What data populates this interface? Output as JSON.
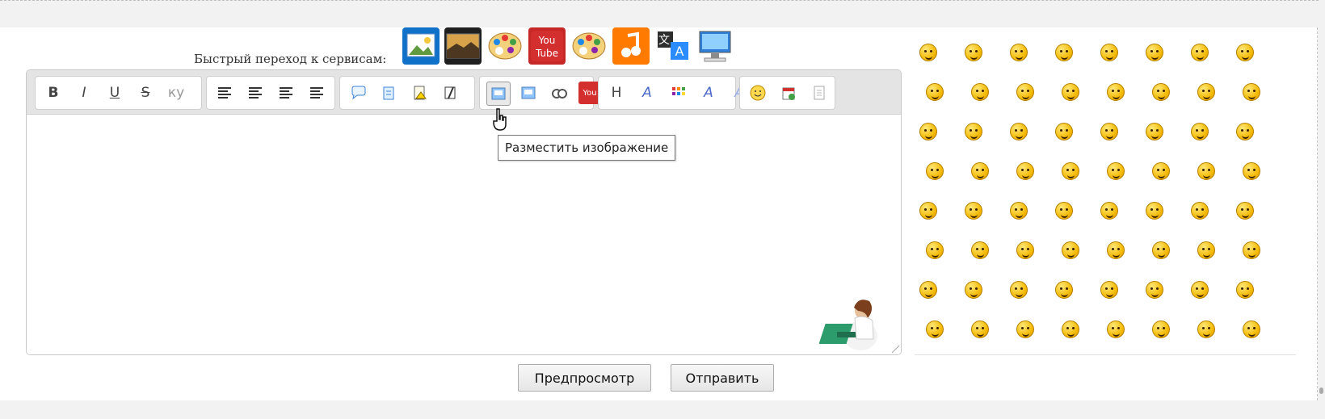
{
  "quick_services_label": "Быстрый переход к сервисам:",
  "service_icons": [
    "photo-icon",
    "sunset-photo-icon",
    "palette-icon",
    "youtube-icon",
    "palette-icon",
    "music-icon",
    "translate-icon",
    "computer-icon"
  ],
  "toolbar": {
    "groups": [
      {
        "name": "text-format",
        "buttons": [
          {
            "name": "bold",
            "label": "B"
          },
          {
            "name": "italic",
            "label": "I"
          },
          {
            "name": "underline",
            "label": "U"
          },
          {
            "name": "strikethrough",
            "label": "S"
          },
          {
            "name": "blur",
            "label": "ку"
          }
        ]
      },
      {
        "name": "align",
        "buttons": [
          {
            "name": "align-left",
            "label": ""
          },
          {
            "name": "align-center",
            "label": ""
          },
          {
            "name": "align-right",
            "label": ""
          },
          {
            "name": "align-justify",
            "label": ""
          }
        ]
      },
      {
        "name": "blocks",
        "buttons": [
          {
            "name": "quote",
            "label": ""
          },
          {
            "name": "reply-quote",
            "label": ""
          },
          {
            "name": "spoiler",
            "label": ""
          },
          {
            "name": "note",
            "label": ""
          }
        ]
      },
      {
        "name": "media",
        "buttons": [
          {
            "name": "insert-image",
            "label": ""
          },
          {
            "name": "insert-image-add",
            "label": ""
          },
          {
            "name": "insert-link",
            "label": ""
          },
          {
            "name": "youtube",
            "label": "You"
          }
        ]
      },
      {
        "name": "font",
        "buttons": [
          {
            "name": "heading",
            "label": "H"
          },
          {
            "name": "font-size",
            "label": "A"
          },
          {
            "name": "color",
            "label": ""
          },
          {
            "name": "font-style",
            "label": "A"
          },
          {
            "name": "font-clear",
            "label": "A"
          }
        ]
      },
      {
        "name": "misc",
        "buttons": [
          {
            "name": "smiley",
            "label": ""
          },
          {
            "name": "calendar",
            "label": ""
          },
          {
            "name": "source",
            "label": ""
          }
        ]
      }
    ]
  },
  "tooltip": "Разместить изображение",
  "preview_button": "Предпросмотр",
  "submit_button": "Отправить"
}
